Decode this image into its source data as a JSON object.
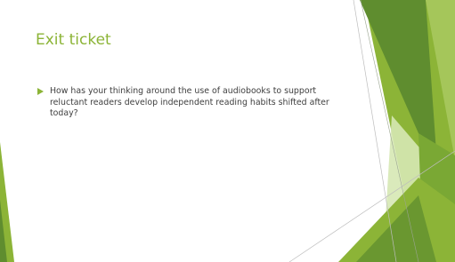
{
  "slide": {
    "title": "Exit ticket",
    "bullets": [
      "How has your thinking around the use of audiobooks to support reluctant readers develop independent reading habits shifted after today?"
    ]
  },
  "theme": {
    "accent": "#8cb437",
    "dark_green": "#5f8d2f",
    "light_green": "#d6e8b4",
    "text": "#404040"
  },
  "icons": {
    "bullet": "triangle-right-icon"
  }
}
